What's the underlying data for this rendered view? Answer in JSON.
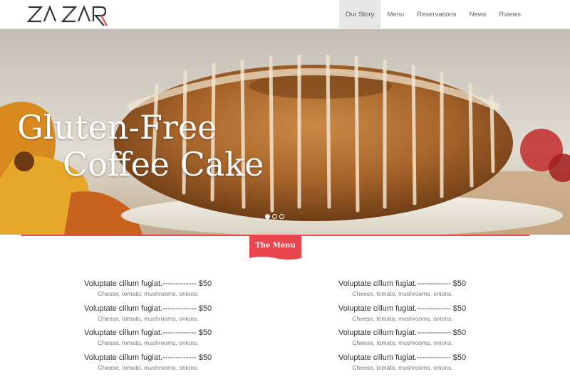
{
  "brand": {
    "logo_text": "ZA ZAR"
  },
  "nav": {
    "items": [
      {
        "label": "Our Story",
        "active": true
      },
      {
        "label": "Menu"
      },
      {
        "label": "Reservations"
      },
      {
        "label": "News"
      },
      {
        "label": "Rviews"
      }
    ]
  },
  "hero": {
    "title_line1": "Gluten-Free",
    "title_line2": "Coffee Cake",
    "slides": 3,
    "active_slide": 1
  },
  "menu_section": {
    "heading": "The Menu",
    "left_items": [
      {
        "title": "Voluptate cillum fugiat.------------- $50",
        "desc": "Cheese, tomato, mushrooms, onions."
      },
      {
        "title": "Voluptate cillum fugiat.------------- $50",
        "desc": "Cheese, tomato, mushrooms, onions."
      },
      {
        "title": "Voluptate cillum fugiat.------------- $50",
        "desc": "Cheese, tomato, mushrooms, onions."
      },
      {
        "title": "Voluptate cillum fugiat.------------- $50",
        "desc": "Cheese, tomato, mushrooms, onions."
      }
    ],
    "right_items": [
      {
        "title": "Voluptate cillum fugiat.------------- $50",
        "desc": "Cheese, tomato, mushrooms, onions."
      },
      {
        "title": "Voluptate cillum fugiat.------------- $50",
        "desc": "Cheese, tomato, mushrooms, onions."
      },
      {
        "title": "Voluptate cillum fugiat.------------- $50",
        "desc": "Cheese, tomato, mushrooms, onions."
      },
      {
        "title": "Voluptate cillum fugiat.------------- $50",
        "desc": "Cheese, tomato, mushrooms, onions."
      }
    ]
  },
  "colors": {
    "accent": "#e8454d",
    "nav_active_bg": "#e7e7e7",
    "text_dark": "#333333",
    "text_muted": "#777777"
  },
  "icons": {
    "logo": "zazar-logo-icon",
    "slider_dot": "slider-dot-icon"
  }
}
